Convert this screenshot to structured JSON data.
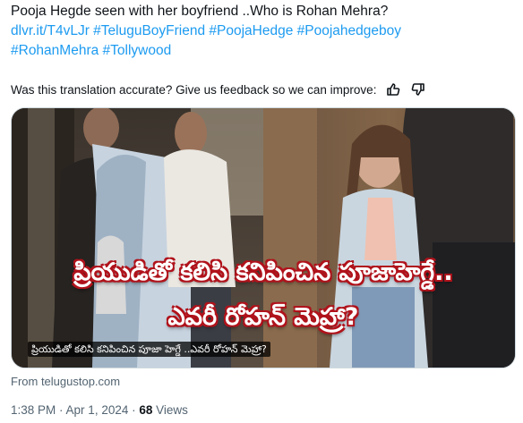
{
  "tweet": {
    "title": "Pooja Hegde seen with her boyfriend ..Who is Rohan Mehra?",
    "link_line": "dlvr.it/T4vLJr #TeluguBoyFriend #PoojaHedge #Poojahedgeboy",
    "hashtags_line": "#RohanMehra #Tollywood"
  },
  "feedback": {
    "text": "Was this translation accurate? Give us feedback so we can improve:",
    "icons": [
      "thumbs-up-icon",
      "thumbs-down-icon"
    ]
  },
  "media": {
    "headline_line1": "ప్రియుడితో కలిసి కనిపించిన పూజాహెగ్డే..",
    "headline_line2": "ఎవరీ రోహన్ మెహ్రా?",
    "caption": "ప్రియుడితో కలిసి కనిపించిన పూజా హెగ్డే ..ఎవరీ రోహన్ మెహ్రా?"
  },
  "source": "From telugustop.com",
  "meta": {
    "time": "1:38 PM",
    "separator1": " · ",
    "date": "Apr 1, 2024",
    "separator2": " · ",
    "views_count": "68",
    "views_label": " Views"
  },
  "colors": {
    "link": "#1d9bf0",
    "text": "#0f1419",
    "muted": "#536471",
    "headline_outline": "#b0121b"
  }
}
